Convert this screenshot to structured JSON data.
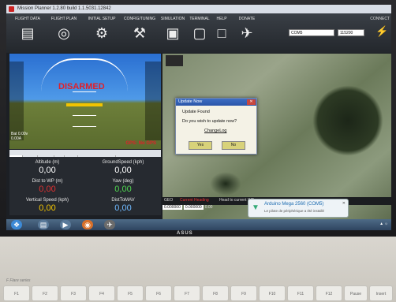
{
  "window": {
    "title": "Mission Planner 1.2.80 build 1.1.5031.12842"
  },
  "menu": [
    {
      "label": "FLIGHT DATA",
      "icon": "clipboard-icon"
    },
    {
      "label": "FLIGHT PLAN",
      "icon": "globe-icon"
    },
    {
      "label": "INITIAL SETUP",
      "icon": "gear-icon"
    },
    {
      "label": "CONFIG/TUNING",
      "icon": "wrench-icon"
    },
    {
      "label": "SIMULATION",
      "icon": "monitor-icon"
    },
    {
      "label": "TERMINAL",
      "icon": "terminal-icon"
    },
    {
      "label": "HELP",
      "icon": "help-icon"
    },
    {
      "label": "DONATE",
      "icon": "plane-icon"
    }
  ],
  "connection": {
    "port": "COM5",
    "baud": "115200",
    "connect_label": "CONNECT"
  },
  "hud": {
    "status": "DISARMED",
    "gps": "GPS: No GPS",
    "battery": "Bat 0.00v",
    "current": "0.00A"
  },
  "tabs": [
    "Quick",
    "Actions",
    "Gauges",
    "Stat",
    "Servo",
    "Journaux du Telemetr"
  ],
  "quick": [
    {
      "label": "Altitude (m)",
      "value": "0,00",
      "color": "#ffffff"
    },
    {
      "label": "GroundSpeed (kph)",
      "value": "0,00",
      "color": "#ffffff"
    },
    {
      "label": "Dist to WP (m)",
      "value": "0,00",
      "color": "#e03030"
    },
    {
      "label": "Yaw (deg)",
      "value": "0,00",
      "color": "#4fd64f"
    },
    {
      "label": "Vertical Speed (kph)",
      "value": "0,00",
      "color": "#f2c400"
    },
    {
      "label": "DistToMAV",
      "value": "0,00",
      "color": "#6fb9ff"
    }
  ],
  "map": {
    "mode_label": "GEO",
    "error_label": "Current Heading",
    "heading_label": "Head to current WP",
    "lat": "0.000000",
    "lng": "0.000000",
    "alt": "0.00"
  },
  "dialog": {
    "title": "Update Now",
    "line1": "Update Found",
    "line2": "Do you wish to update now?",
    "link": "ChangeLog",
    "yes": "Yes",
    "no": "No"
  },
  "balloon": {
    "title": "Arduino Mega 2560 (COM5)",
    "subtitle": "Le pilote de périphérique a été installé"
  },
  "brand": "ASUS",
  "keyboard": {
    "series": "F Flare series",
    "keys": [
      "F1",
      "F2",
      "F3",
      "F4",
      "F5",
      "F6",
      "F7",
      "F8",
      "F9",
      "F10",
      "F11",
      "F12",
      "Pause",
      "Insert"
    ]
  }
}
